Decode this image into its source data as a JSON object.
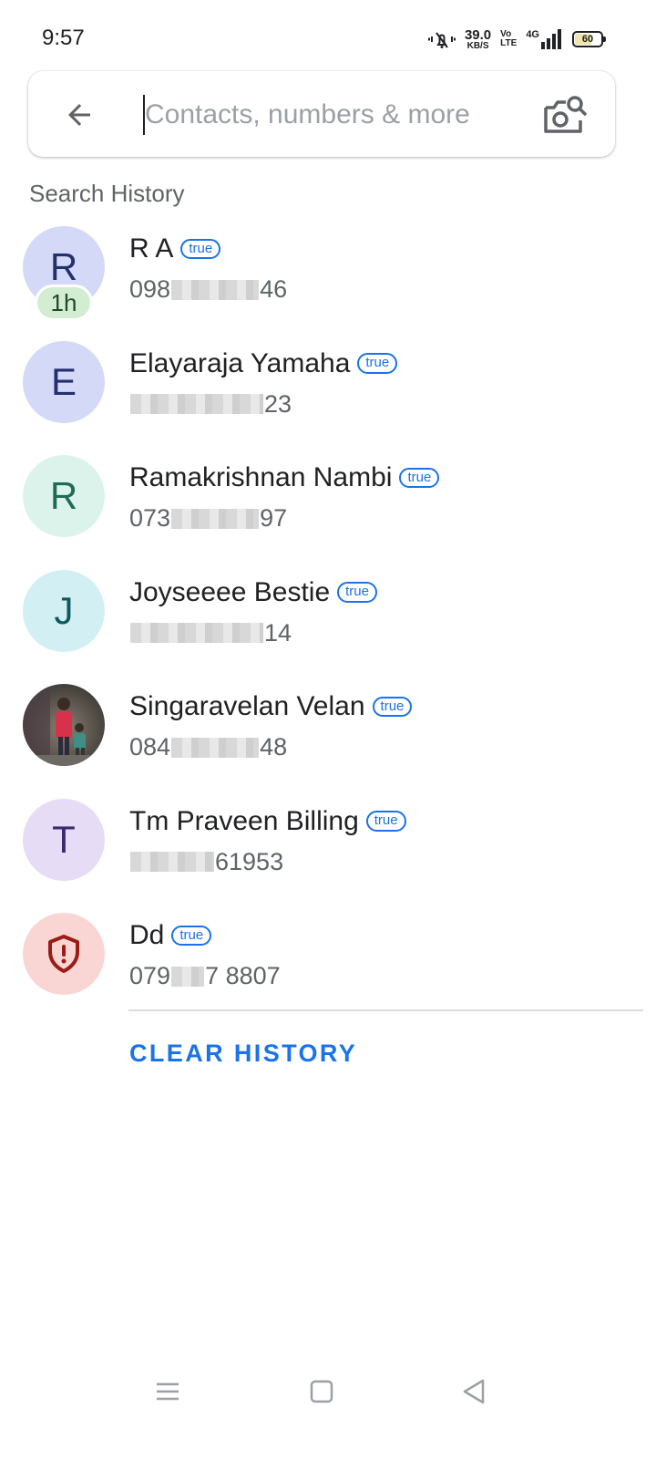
{
  "status_bar": {
    "time": "9:57",
    "net_speed_value": "39.0",
    "net_speed_unit": "KB/S",
    "volte_top": "Vo",
    "volte_bottom": "LTE",
    "network_type": "4G",
    "battery": "60",
    "icons": [
      "vibrate-mute-icon",
      "signal-icon",
      "battery-icon"
    ]
  },
  "search": {
    "placeholder": "Contacts, numbers & more",
    "value": "",
    "back_icon": "arrow-back-icon",
    "camera_icon": "camera-search-icon"
  },
  "section_title": "Search History",
  "history": [
    {
      "initial": "R",
      "name": "R A",
      "tag": "true",
      "num_prefix": "098",
      "num_suffix": "46",
      "avatar_bg": "#d4d9f7",
      "avatar_fg": "#23306e",
      "badge": "1h"
    },
    {
      "initial": "E",
      "name": "Elayaraja Yamaha",
      "tag": "true",
      "num_prefix": "",
      "num_suffix": "23",
      "avatar_bg": "#d4d9f7",
      "avatar_fg": "#23306e"
    },
    {
      "initial": "R",
      "name": "Ramakrishnan Nambi",
      "tag": "true",
      "num_prefix": "073",
      "num_suffix": "97",
      "avatar_bg": "#dcf3ec",
      "avatar_fg": "#1f6b55"
    },
    {
      "initial": "J",
      "name": "Joyseeee Bestie",
      "tag": "true",
      "num_prefix": "",
      "num_suffix": "14",
      "avatar_bg": "#d2eff3",
      "avatar_fg": "#0d5a5e"
    },
    {
      "initial": "",
      "name": "Singaravelan Velan",
      "tag": "true",
      "num_prefix": "084",
      "num_suffix": "48",
      "photo": true
    },
    {
      "initial": "T",
      "name": "Tm Praveen Billing",
      "tag": "true",
      "num_prefix": "",
      "num_suffix": " 61953",
      "avatar_bg": "#e6dcf6",
      "avatar_fg": "#3b2a70"
    },
    {
      "initial": "",
      "name": "Dd",
      "tag": "true",
      "num_prefix": "079 ",
      "num_suffix": "7 8807",
      "avatar_bg": "#f9d6d3",
      "avatar_fg": "#9b1c16",
      "spam": true
    }
  ],
  "clear_history_label": "CLEAR HISTORY",
  "nav": {
    "menu_icon": "menu-icon",
    "home_icon": "home-square-icon",
    "back_icon": "back-triangle-icon"
  },
  "colors": {
    "accent": "#1a73e8",
    "secondary_text": "#5f6368",
    "badge_bg": "#d3edd3"
  }
}
